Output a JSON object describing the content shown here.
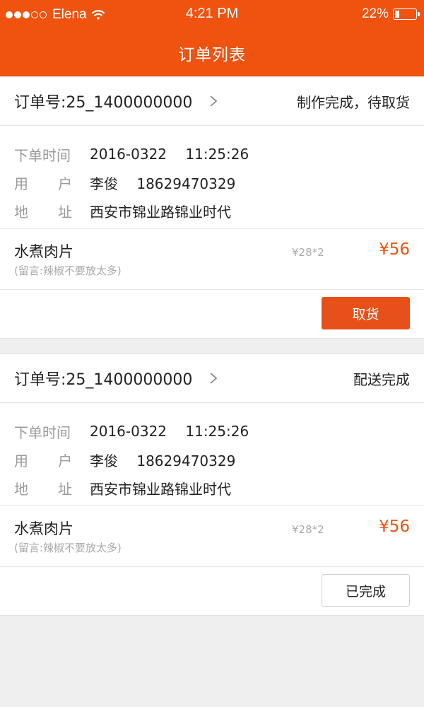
{
  "status_bar": {
    "carrier": "Elena",
    "time": "4:21 PM",
    "battery": "22%",
    "battery_level": 0.22
  },
  "header": {
    "title": "订单列表"
  },
  "labels": {
    "order_time": "下单时间",
    "user_a": "用",
    "user_b": "户",
    "address_a": "地",
    "address_b": "址"
  },
  "orders": [
    {
      "order_no": "订单号:25_1400000000",
      "status": "制作完成，待取货",
      "order_time": "2016-0322",
      "order_clock": "11:25:26",
      "user_name": "李俊",
      "user_phone": "18629470329",
      "address": "西安市锦业路锦业时代",
      "item_name": "水煮肉片",
      "item_note": "(留言:辣椒不要放太多)",
      "item_unit": "¥28*2",
      "item_price": "¥56",
      "action_label": "取货"
    },
    {
      "order_no": "订单号:25_1400000000",
      "status": "配送完成",
      "order_time": "2016-0322",
      "order_clock": "11:25:26",
      "user_name": "李俊",
      "user_phone": "18629470329",
      "address": "西安市锦业路锦业时代",
      "item_name": "水煮肉片",
      "item_note": "(留言:辣椒不要放太多)",
      "item_unit": "¥28*2",
      "item_price": "¥56",
      "action_label": "已完成"
    }
  ],
  "colors": {
    "brand": "#f0520f",
    "price": "#f0520f",
    "background": "#efefef"
  }
}
